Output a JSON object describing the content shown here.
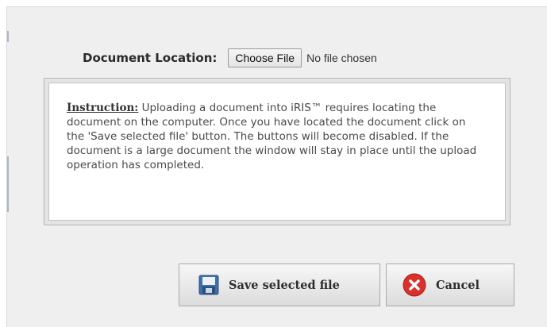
{
  "location": {
    "label": "Document Location:",
    "choose_button": "Choose File",
    "status": "No file chosen"
  },
  "instruction": {
    "title": "Instruction:",
    "body": " Uploading a document into iRIS™ requires locating the document on the computer. Once you have located the document click on the 'Save selected file' button. The buttons will become disabled. If the document is a large document the window will stay in place until the upload operation has completed."
  },
  "buttons": {
    "save": {
      "label": "Save selected file",
      "icon": "floppy-disk-icon"
    },
    "cancel": {
      "label": "Cancel",
      "icon": "red-x-circle-icon"
    }
  },
  "colors": {
    "cancel_icon": "#d9302c",
    "save_icon": "#3f6fa8"
  }
}
